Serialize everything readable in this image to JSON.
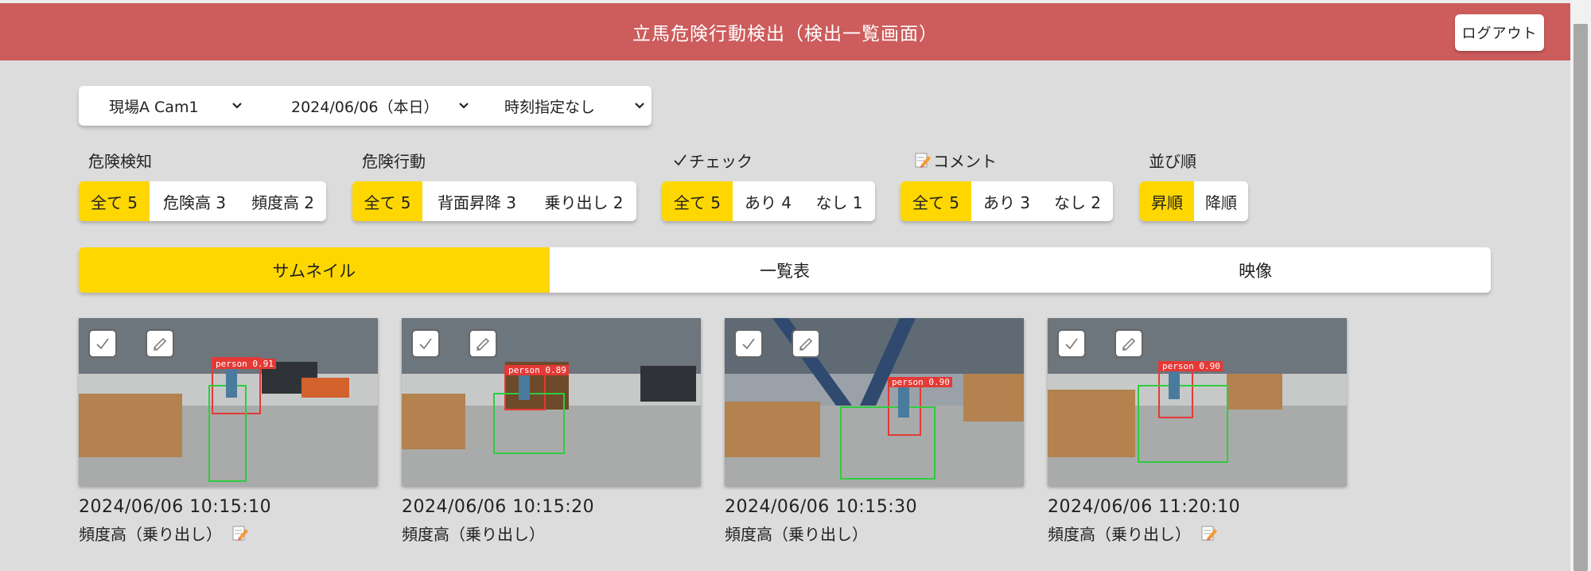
{
  "header": {
    "title": "立馬危険行動検出（検出一覧画面）",
    "logout_label": "ログアウト"
  },
  "filters": {
    "camera": "現場A Cam1",
    "date": "2024/06/06（本日）",
    "time": "時刻指定なし"
  },
  "groups": {
    "risk_detect": {
      "label": "危険検知",
      "options": [
        "全て 5",
        "危険高 3",
        "頻度高 2"
      ]
    },
    "risk_action": {
      "label": "危険行動",
      "options": [
        "全て 5",
        "背面昇降 3",
        "乗り出し 2"
      ]
    },
    "check": {
      "label": "チェック",
      "options": [
        "全て 5",
        "あり 4",
        "なし 1"
      ]
    },
    "comment": {
      "label": "コメント",
      "options": [
        "全て 5",
        "あり 3",
        "なし 2"
      ]
    },
    "sort": {
      "label": "並び順",
      "options": [
        "昇順",
        "降順"
      ]
    }
  },
  "tabs": [
    "サムネイル",
    "一覧表",
    "映像"
  ],
  "cards": [
    {
      "time": "2024/06/06  10:15:10",
      "desc": "頻度高（乗り出し）",
      "box_label": "person 0.91"
    },
    {
      "time": "2024/06/06  10:15:20",
      "desc": "頻度高（乗り出し）",
      "box_label": "person 0.89"
    },
    {
      "time": "2024/06/06  10:15:30",
      "desc": "頻度高（乗り出し）",
      "box_label": "person 0.90"
    },
    {
      "time": "2024/06/06  11:20:10",
      "desc": "頻度高（乗り出し）",
      "box_label": "person 0.90"
    }
  ],
  "colors": {
    "header": "#cd5c5c",
    "accent": "#ffd700",
    "background": "#dcdcdc"
  },
  "icons": {
    "check": "check-icon",
    "comment": "memo-pencil-icon",
    "dropdown": "chevron-down-icon"
  }
}
